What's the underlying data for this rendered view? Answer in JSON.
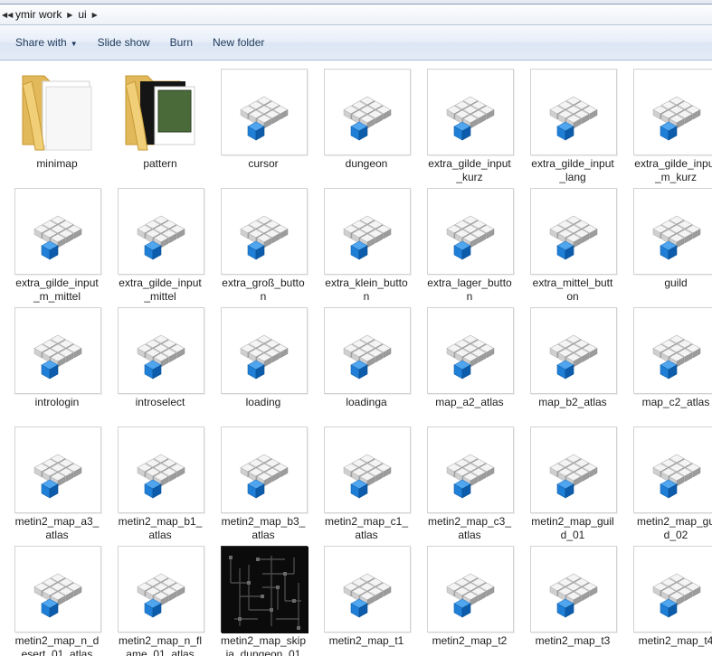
{
  "breadcrumb": [
    "ymir work",
    "ui"
  ],
  "toolbar": {
    "share_with": "Share with",
    "slide_show": "Slide show",
    "burn": "Burn",
    "new_folder": "New folder"
  },
  "files": [
    {
      "line1": "minimap",
      "line2": "",
      "kind": "folder",
      "icon": "folder-icon"
    },
    {
      "line1": "pattern",
      "line2": "",
      "kind": "folder-preview",
      "icon": "folder-preview-icon"
    },
    {
      "line1": "cursor",
      "line2": "",
      "kind": "model",
      "icon": "3d-model-file-icon"
    },
    {
      "line1": "dungeon",
      "line2": "",
      "kind": "model",
      "icon": "3d-model-file-icon"
    },
    {
      "line1": "extra_gilde_input",
      "line2": "_kurz",
      "kind": "model",
      "icon": "3d-model-file-icon"
    },
    {
      "line1": "extra_gilde_input",
      "line2": "_lang",
      "kind": "model",
      "icon": "3d-model-file-icon"
    },
    {
      "line1": "extra_gilde_input",
      "line2": "_m_kurz",
      "kind": "model",
      "icon": "3d-model-file-icon"
    },
    {
      "line1": "extra_gilde_input",
      "line2": "_m_mittel",
      "kind": "model",
      "icon": "3d-model-file-icon"
    },
    {
      "line1": "extra_gilde_input",
      "line2": "_mittel",
      "kind": "model",
      "icon": "3d-model-file-icon"
    },
    {
      "line1": "extra_groß_butto",
      "line2": "n",
      "kind": "model",
      "icon": "3d-model-file-icon"
    },
    {
      "line1": "extra_klein_butto",
      "line2": "n",
      "kind": "model",
      "icon": "3d-model-file-icon"
    },
    {
      "line1": "extra_lager_butto",
      "line2": "n",
      "kind": "model",
      "icon": "3d-model-file-icon"
    },
    {
      "line1": "extra_mittel_butt",
      "line2": "on",
      "kind": "model",
      "icon": "3d-model-file-icon"
    },
    {
      "line1": "guild",
      "line2": "",
      "kind": "model",
      "icon": "3d-model-file-icon"
    },
    {
      "line1": "intrologin",
      "line2": "",
      "kind": "model",
      "icon": "3d-model-file-icon"
    },
    {
      "line1": "introselect",
      "line2": "",
      "kind": "model",
      "icon": "3d-model-file-icon"
    },
    {
      "line1": "loading",
      "line2": "",
      "kind": "model",
      "icon": "3d-model-file-icon"
    },
    {
      "line1": "loadinga",
      "line2": "",
      "kind": "model",
      "icon": "3d-model-file-icon"
    },
    {
      "line1": "map_a2_atlas",
      "line2": "",
      "kind": "model",
      "icon": "3d-model-file-icon"
    },
    {
      "line1": "map_b2_atlas",
      "line2": "",
      "kind": "model",
      "icon": "3d-model-file-icon"
    },
    {
      "line1": "map_c2_atlas",
      "line2": "",
      "kind": "model",
      "icon": "3d-model-file-icon"
    },
    {
      "line1": "metin2_map_a3_",
      "line2": "atlas",
      "kind": "model",
      "icon": "3d-model-file-icon"
    },
    {
      "line1": "metin2_map_b1_",
      "line2": "atlas",
      "kind": "model",
      "icon": "3d-model-file-icon"
    },
    {
      "line1": "metin2_map_b3_",
      "line2": "atlas",
      "kind": "model",
      "icon": "3d-model-file-icon"
    },
    {
      "line1": "metin2_map_c1_",
      "line2": "atlas",
      "kind": "model",
      "icon": "3d-model-file-icon"
    },
    {
      "line1": "metin2_map_c3_",
      "line2": "atlas",
      "kind": "model",
      "icon": "3d-model-file-icon"
    },
    {
      "line1": "metin2_map_guil",
      "line2": "d_01",
      "kind": "model",
      "icon": "3d-model-file-icon"
    },
    {
      "line1": "metin2_map_gu",
      "line2": "d_02",
      "kind": "model",
      "icon": "3d-model-file-icon"
    },
    {
      "line1": "metin2_map_n_d",
      "line2": "esert_01_atlas",
      "kind": "model",
      "icon": "3d-model-file-icon"
    },
    {
      "line1": "metin2_map_n_fl",
      "line2": "ame_01_atlas",
      "kind": "model",
      "icon": "3d-model-file-icon"
    },
    {
      "line1": "metin2_map_skip",
      "line2": "ia_dungeon_01",
      "kind": "dark",
      "icon": "dungeon-map-preview-icon"
    },
    {
      "line1": "metin2_map_t1",
      "line2": "",
      "kind": "model",
      "icon": "3d-model-file-icon"
    },
    {
      "line1": "metin2_map_t2",
      "line2": "",
      "kind": "model",
      "icon": "3d-model-file-icon"
    },
    {
      "line1": "metin2_map_t3",
      "line2": "",
      "kind": "model",
      "icon": "3d-model-file-icon"
    },
    {
      "line1": "metin2_map_t4",
      "line2": "",
      "kind": "model",
      "icon": "3d-model-file-icon"
    }
  ]
}
